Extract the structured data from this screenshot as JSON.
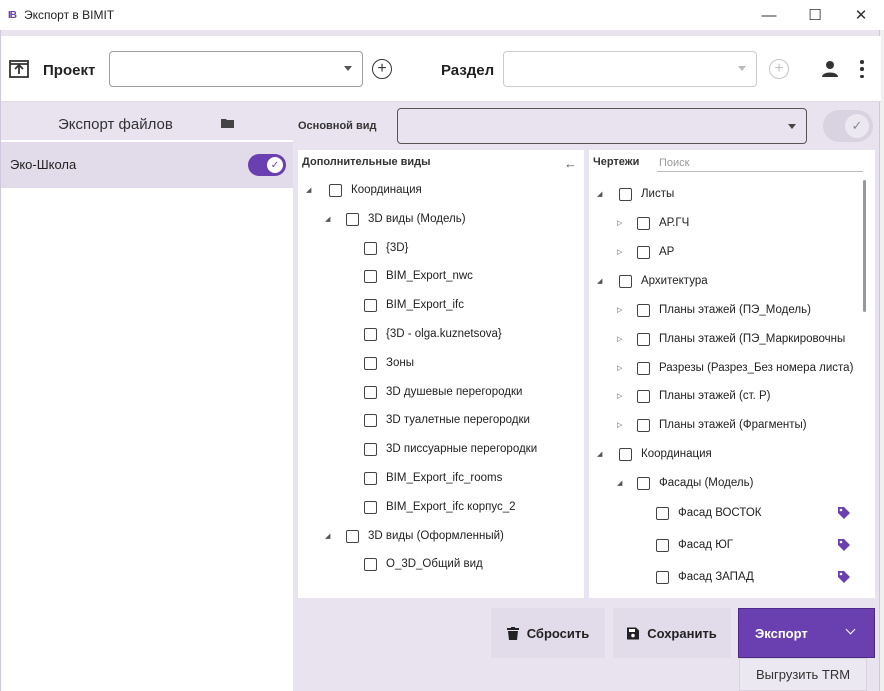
{
  "window": {
    "logo": "IB",
    "title": "Экспорт в BIMIT",
    "minimize": "—",
    "maximize": "☐",
    "close": "✕"
  },
  "topbar": {
    "project_label": "Проект",
    "project_value": "",
    "section_label": "Раздел",
    "section_value": "",
    "add_glyph": "+"
  },
  "left_panel": {
    "title": "Экспорт файлов",
    "items": [
      {
        "label": "Эко-Школа",
        "enabled": true
      }
    ],
    "toggle_check": "✓"
  },
  "main_view": {
    "label": "Основной вид",
    "value": "",
    "check": "✓"
  },
  "additional_views": {
    "title": "Дополнительные виды",
    "back": "←",
    "tree": [
      {
        "label": "Координация",
        "toggle": "◢"
      },
      {
        "label": "3D виды (Модель)",
        "toggle": "◢"
      },
      {
        "label": "{3D}",
        "toggle": ""
      },
      {
        "label": "BIM_Export_nwc",
        "toggle": ""
      },
      {
        "label": "BIM_Export_ifc",
        "toggle": ""
      },
      {
        "label": "{3D - olga.kuznetsova}",
        "toggle": ""
      },
      {
        "label": "Зоны",
        "toggle": ""
      },
      {
        "label": "3D душевые перегородки",
        "toggle": ""
      },
      {
        "label": "3D туалетные перегородки",
        "toggle": ""
      },
      {
        "label": "3D писсуарные перегородки",
        "toggle": ""
      },
      {
        "label": "BIM_Export_ifc_rooms",
        "toggle": ""
      },
      {
        "label": "BIM_Export_ifc корпус_2",
        "toggle": ""
      },
      {
        "label": "3D виды (Оформленный)",
        "toggle": "◢"
      },
      {
        "label": "О_3D_Общий вид",
        "toggle": ""
      }
    ]
  },
  "drawings": {
    "title": "Чертежи",
    "search_placeholder": "Поиск",
    "search_value": "",
    "tree": [
      {
        "label": "Листы",
        "toggle": "◢"
      },
      {
        "label": "АР.ГЧ",
        "toggle": "▷"
      },
      {
        "label": "АР",
        "toggle": "▷"
      },
      {
        "label": "Архитектура",
        "toggle": "◢"
      },
      {
        "label": "Планы этажей (ПЭ_Модель)",
        "toggle": "▷"
      },
      {
        "label": "Планы этажей (ПЭ_Маркировочны",
        "toggle": "▷"
      },
      {
        "label": "Разрезы (Разрез_Без номера листа)",
        "toggle": "▷"
      },
      {
        "label": "Планы этажей (ст. Р)",
        "toggle": "▷"
      },
      {
        "label": "Планы этажей (Фрагменты)",
        "toggle": "▷"
      },
      {
        "label": "Координация",
        "toggle": "◢"
      },
      {
        "label": "Фасады (Модель)",
        "toggle": "◢"
      },
      {
        "label": "Фасад ВОСТОК",
        "toggle": "",
        "tag": true
      },
      {
        "label": "Фасад ЮГ",
        "toggle": "",
        "tag": true
      },
      {
        "label": "Фасад ЗАПАД",
        "toggle": "",
        "tag": true
      }
    ]
  },
  "actions": {
    "reset": "Сбросить",
    "save": "Сохранить",
    "export": "Экспорт",
    "export_menu": [
      "Выгрузить TRM"
    ]
  },
  "colors": {
    "accent": "#6a3fb0",
    "panel_bg": "#e9e3f0",
    "tag": "#6a3fb0"
  },
  "icons": [
    "upload-icon",
    "plus-circle-icon",
    "user-icon",
    "kebab-menu-icon",
    "folder-icon",
    "check-icon",
    "back-arrow-icon",
    "trash-icon",
    "save-icon",
    "chevron-down-icon",
    "tag-icon"
  ]
}
